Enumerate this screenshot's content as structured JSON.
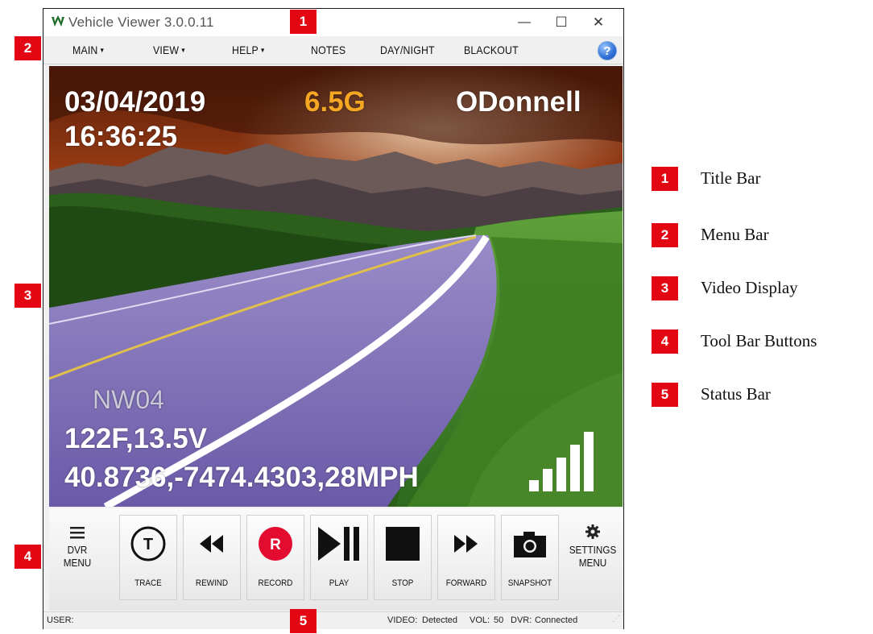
{
  "window": {
    "title": "Vehicle Viewer 3.0.0.11",
    "minimize_glyph": "—",
    "maximize_glyph": "☐",
    "close_glyph": "✕"
  },
  "menu": {
    "items": [
      {
        "label": "MAIN",
        "dropdown": true
      },
      {
        "label": "VIEW",
        "dropdown": true
      },
      {
        "label": "HELP",
        "dropdown": true
      },
      {
        "label": "NOTES",
        "dropdown": false
      },
      {
        "label": "DAY/NIGHT",
        "dropdown": false
      },
      {
        "label": "BLACKOUT",
        "dropdown": false
      }
    ],
    "help_glyph": "?"
  },
  "video": {
    "date": "03/04/2019",
    "time": "16:36:25",
    "gforce": "6.5G",
    "officer": "ODonnell",
    "unit": "NW04",
    "temp_voltage": "122F,13.5V",
    "gps_speed": "40.8736,-7474.4303,28MPH",
    "signal_level": 5,
    "colors": {
      "gforce": "#f5a623",
      "text": "#ffffff"
    }
  },
  "toolbar": {
    "dvr_menu": {
      "line1": "DVR",
      "line2": "MENU",
      "icon": "hamburger-icon"
    },
    "buttons": [
      {
        "label": "TRACE",
        "icon": "trace-icon",
        "glyph": "T"
      },
      {
        "label": "REWIND",
        "icon": "rewind-icon"
      },
      {
        "label": "RECORD",
        "icon": "record-icon",
        "glyph": "R",
        "color": "#e30b2f"
      },
      {
        "label": "PLAY",
        "icon": "play-pause-icon"
      },
      {
        "label": "STOP",
        "icon": "stop-icon"
      },
      {
        "label": "FORWARD",
        "icon": "forward-icon"
      },
      {
        "label": "SNAPSHOT",
        "icon": "camera-icon"
      }
    ],
    "settings_menu": {
      "line1": "SETTINGS",
      "line2": "MENU",
      "icon": "gear-icon"
    }
  },
  "status": {
    "user_label": "USER:",
    "user_value": "",
    "video_label": "VIDEO:",
    "video_value": "Detected",
    "vol_label": "VOL:",
    "vol_value": "50",
    "dvr_label": "DVR:",
    "dvr_value": "Connected"
  },
  "callouts": {
    "color": "#e30613",
    "numbers": [
      "1",
      "2",
      "3",
      "4",
      "5"
    ]
  },
  "legend": [
    {
      "number": "1",
      "label": "Title Bar"
    },
    {
      "number": "2",
      "label": "Menu Bar"
    },
    {
      "number": "3",
      "label": "Video Display"
    },
    {
      "number": "4",
      "label": "Tool Bar Buttons"
    },
    {
      "number": "5",
      "label": "Status Bar"
    }
  ]
}
